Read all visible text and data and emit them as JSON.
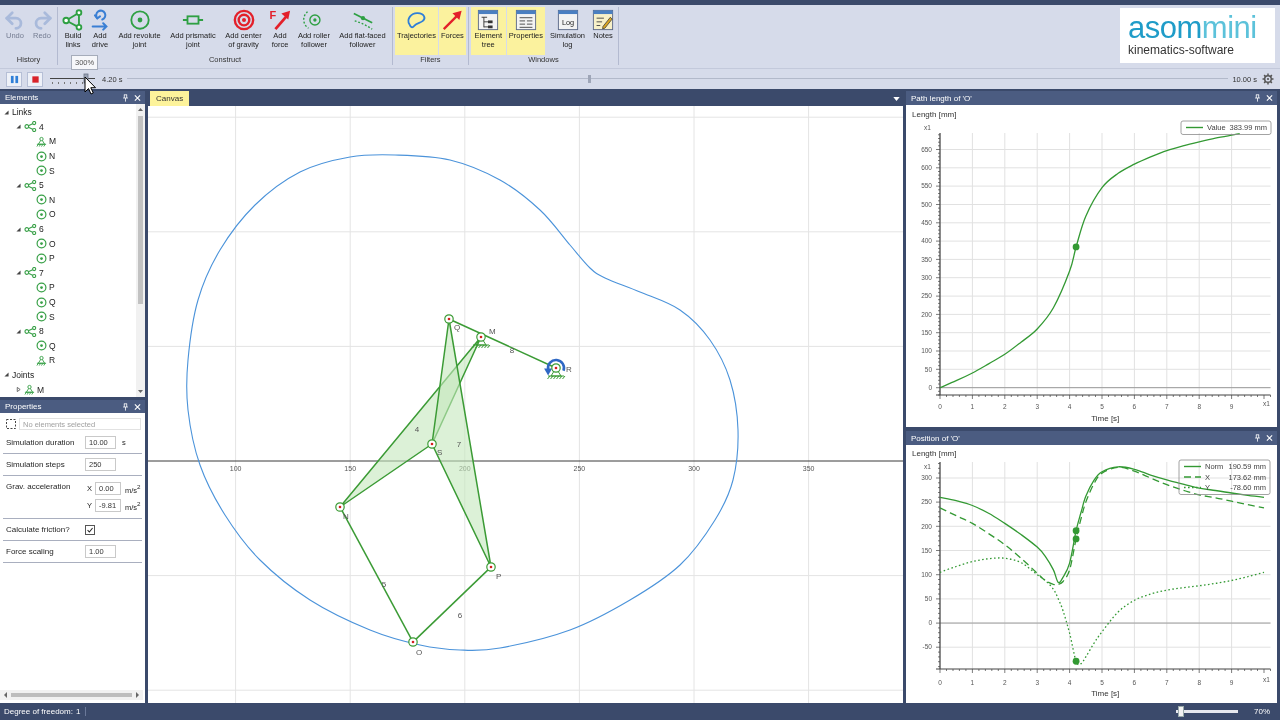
{
  "ribbon": {
    "groups": [
      {
        "label": "History",
        "tools": [
          {
            "kind": "undo",
            "label": "Undo",
            "disabled": true
          },
          {
            "kind": "redo",
            "label": "Redo",
            "disabled": true
          }
        ]
      },
      {
        "label": "Construct",
        "tools": [
          {
            "kind": "build",
            "label": "Build links",
            "disabled": false
          },
          {
            "kind": "drive",
            "label": "Add drive",
            "disabled": false
          },
          {
            "kind": "revolute",
            "label": "Add revolute joint",
            "disabled": false
          },
          {
            "kind": "prismatic",
            "label": "Add prismatic joint",
            "disabled": false
          },
          {
            "kind": "gravity",
            "label": "Add center of gravity",
            "disabled": false
          },
          {
            "kind": "force",
            "label": "Add force",
            "glyph": "F",
            "disabled": false
          },
          {
            "kind": "roller",
            "label": "Add roller follower",
            "disabled": false
          },
          {
            "kind": "flat",
            "label": "Add flat-faced follower",
            "disabled": false
          }
        ]
      },
      {
        "label": "Filters",
        "tools": [
          {
            "kind": "trajectories",
            "label": "Trajectories",
            "on": true
          },
          {
            "kind": "forces",
            "label": "Forces",
            "on": true
          }
        ]
      },
      {
        "label": "Windows",
        "tools": [
          {
            "kind": "element_tree",
            "label": "Element tree",
            "on": true
          },
          {
            "kind": "properties",
            "label": "Properties",
            "on": true
          },
          {
            "kind": "log",
            "label": "Simulation log",
            "glyph": "Log",
            "on": false
          },
          {
            "kind": "notes",
            "label": "Notes",
            "on": false
          }
        ]
      }
    ],
    "logo": {
      "wordmark": [
        "asom",
        "mini"
      ],
      "tagline": "kinematics-software"
    }
  },
  "tooltip": {
    "text": "300%"
  },
  "playback": {
    "speed_slider": {
      "level": 0.8
    },
    "current_time": "4.20 s",
    "timeline": {
      "level": 0.42
    },
    "end_time": "10.00 s"
  },
  "elements": {
    "title": "Elements",
    "tree": [
      {
        "label": "Links",
        "expanded": true,
        "children": [
          {
            "label": "4",
            "kind": "link",
            "expanded": true,
            "children": [
              {
                "label": "M",
                "kind": "ground"
              },
              {
                "label": "N",
                "kind": "revolute"
              },
              {
                "label": "S",
                "kind": "revolute"
              }
            ]
          },
          {
            "label": "5",
            "kind": "link",
            "expanded": true,
            "children": [
              {
                "label": "N",
                "kind": "revolute"
              },
              {
                "label": "O",
                "kind": "revolute"
              }
            ]
          },
          {
            "label": "6",
            "kind": "link",
            "expanded": true,
            "children": [
              {
                "label": "O",
                "kind": "revolute"
              },
              {
                "label": "P",
                "kind": "revolute"
              }
            ]
          },
          {
            "label": "7",
            "kind": "link",
            "expanded": true,
            "children": [
              {
                "label": "P",
                "kind": "revolute"
              },
              {
                "label": "Q",
                "kind": "revolute"
              },
              {
                "label": "S",
                "kind": "revolute"
              }
            ]
          },
          {
            "label": "8",
            "kind": "link",
            "expanded": true,
            "children": [
              {
                "label": "Q",
                "kind": "revolute"
              },
              {
                "label": "R",
                "kind": "ground"
              }
            ]
          }
        ]
      },
      {
        "label": "Joints",
        "expanded": true,
        "children": [
          {
            "label": "M",
            "kind": "ground",
            "expanded": false
          }
        ]
      }
    ]
  },
  "properties": {
    "title": "Properties",
    "selection": {
      "placeholder": "No elements selected"
    },
    "rows": [
      {
        "kind": "field",
        "label": "Simulation duration",
        "value": "10.00",
        "unit": "s"
      },
      {
        "kind": "field",
        "label": "Simulation steps",
        "value": "250"
      },
      {
        "kind": "vector",
        "label": "Grav. acceleration",
        "components": [
          {
            "axis": "X",
            "value": "0.00",
            "unit": "m/s$^{2}$"
          },
          {
            "axis": "Y",
            "value": "-9.81",
            "unit": "m/s$^{2}$"
          }
        ]
      },
      {
        "kind": "checkbox",
        "label": "Calculate friction?",
        "checked": true
      },
      {
        "kind": "field",
        "label": "Force scaling",
        "value": "1.00"
      }
    ]
  },
  "canvas": {
    "tab": {
      "label": "Canvas",
      "selected": true
    },
    "axis_ticks": [
      "100",
      "150",
      "200",
      "250",
      "300",
      "350"
    ],
    "links": [
      {
        "label": "4",
        "kind": "plate"
      },
      {
        "label": "7",
        "kind": "plate"
      },
      {
        "label": "8",
        "kind": "bar"
      },
      {
        "label": "5",
        "kind": "bar"
      },
      {
        "label": "6",
        "kind": "bar"
      }
    ],
    "joints": [
      {
        "label": "Q",
        "kind": "revolute"
      },
      {
        "label": "M",
        "kind": "ground"
      },
      {
        "label": "R",
        "kind": "drive"
      },
      {
        "label": "S",
        "kind": "revolute"
      },
      {
        "label": "N",
        "kind": "revolute"
      },
      {
        "label": "P",
        "kind": "revolute"
      },
      {
        "label": "O",
        "kind": "revolute"
      }
    ]
  },
  "charts": [
    {
      "title": "Path length of 'O'",
      "legend_readings": [
        "383.99 mm"
      ],
      "chart_data": [
        {
          "type": "line",
          "ylabel": "Length [mm]",
          "xlabel": "Time [s]",
          "annotations": [
            "x1",
            "x1"
          ],
          "x": [
            0,
            0.5,
            1,
            1.5,
            2,
            2.5,
            3,
            3.5,
            4,
            4.2,
            4.5,
            5,
            5.5,
            6,
            6.5,
            7,
            7.5,
            8,
            8.5,
            9,
            9.25
          ],
          "series": [
            {
              "name": "Value",
              "color": "#339933",
              "line_style": "solid",
              "values": [
                0,
                19,
                40,
                65,
                91,
                124,
                160,
                218,
                318,
                384,
                468,
                546,
                585,
                610,
                630,
                647,
                660,
                671,
                681,
                689,
                693
              ]
            },
            {
              "type": "scatter",
              "color": "#339933",
              "values": [
                null,
                null,
                null,
                null,
                null,
                null,
                null,
                null,
                null,
                384,
                null,
                null,
                null,
                null,
                null,
                null,
                null,
                null,
                null,
                null,
                null
              ]
            }
          ],
          "xlim": [
            0,
            10.2
          ],
          "ylim": [
            -20,
            695
          ],
          "xticks": [
            0,
            1,
            2,
            3,
            4,
            5,
            6,
            7,
            8,
            9
          ],
          "yticks": [
            0,
            50,
            100,
            150,
            200,
            250,
            300,
            350,
            400,
            450,
            500,
            550,
            600,
            650
          ],
          "grid": true,
          "legend": "top-right"
        }
      ]
    },
    {
      "title": "Position of 'O'",
      "legend_readings": [
        "190.59 mm",
        "173.62 mm",
        "-78.60 mm"
      ],
      "chart_data": [
        {
          "type": "line",
          "ylabel": "Length [mm]",
          "xlabel": "Time [s]",
          "annotations": [
            "x1",
            "x1"
          ],
          "x": [
            0,
            0.5,
            1,
            1.5,
            2,
            2.5,
            3,
            3.25,
            3.5,
            3.65,
            3.8,
            4,
            4.2,
            4.35,
            4.5,
            4.75,
            5,
            5.5,
            6,
            6.5,
            7,
            7.5,
            8,
            8.5,
            9,
            9.5,
            10
          ],
          "series": [
            {
              "name": "Norm",
              "color": "#339933",
              "line_style": "solid",
              "values": [
                260,
                253,
                243,
                227,
                206,
                183,
                157,
                138,
                110,
                84,
                95,
                124,
                191,
                228,
                262,
                295,
                313,
                323,
                318,
                306,
                296,
                287,
                279,
                274,
                269,
                264,
                260
              ]
            },
            {
              "name": "X",
              "color": "#339933",
              "line_style": "dashed",
              "values": [
                238,
                222,
                206,
                185,
                162,
                134,
                103,
                88,
                80,
                80,
                86,
                110,
                174,
                215,
                250,
                288,
                310,
                322,
                314,
                300,
                286,
                275,
                265,
                259,
                252,
                245,
                238
              ]
            },
            {
              "name": "Y",
              "color": "#339933",
              "line_style": "dotted",
              "values": [
                105,
                117,
                127,
                133,
                134,
                125,
                100,
                88,
                70,
                50,
                25,
                -21,
                -79,
                -84,
                -70,
                -42,
                -18,
                23,
                47,
                60,
                68,
                73,
                77,
                82,
                88,
                96,
                105
              ]
            },
            {
              "type": "scatter",
              "color": "#339933",
              "values": [
                null,
                null,
                null,
                null,
                null,
                null,
                null,
                null,
                null,
                null,
                null,
                null,
                191,
                null,
                null,
                null,
                null,
                null,
                null,
                null,
                null,
                null,
                null,
                null,
                null,
                null,
                null
              ]
            },
            {
              "type": "scatter",
              "color": "#339933",
              "values": [
                null,
                null,
                null,
                null,
                null,
                null,
                null,
                null,
                null,
                null,
                null,
                null,
                174,
                null,
                null,
                null,
                null,
                null,
                null,
                null,
                null,
                null,
                null,
                null,
                null,
                null,
                null
              ]
            },
            {
              "type": "scatter",
              "color": "#339933",
              "values": [
                null,
                null,
                null,
                null,
                null,
                null,
                null,
                null,
                null,
                null,
                null,
                null,
                -79,
                null,
                null,
                null,
                null,
                null,
                null,
                null,
                null,
                null,
                null,
                null,
                null,
                null,
                null
              ]
            }
          ],
          "xlim": [
            0,
            10.2
          ],
          "ylim": [
            -95,
            333
          ],
          "xticks": [
            0,
            1,
            2,
            3,
            4,
            5,
            6,
            7,
            8,
            9
          ],
          "yticks": [
            -50,
            0,
            50,
            100,
            150,
            200,
            250,
            300
          ],
          "grid": true,
          "legend": "top-right"
        }
      ]
    }
  ],
  "status_bar": {
    "label": "Degree of freedom:",
    "value": "1",
    "zoom": {
      "level": 0.05,
      "text": "70%"
    }
  }
}
